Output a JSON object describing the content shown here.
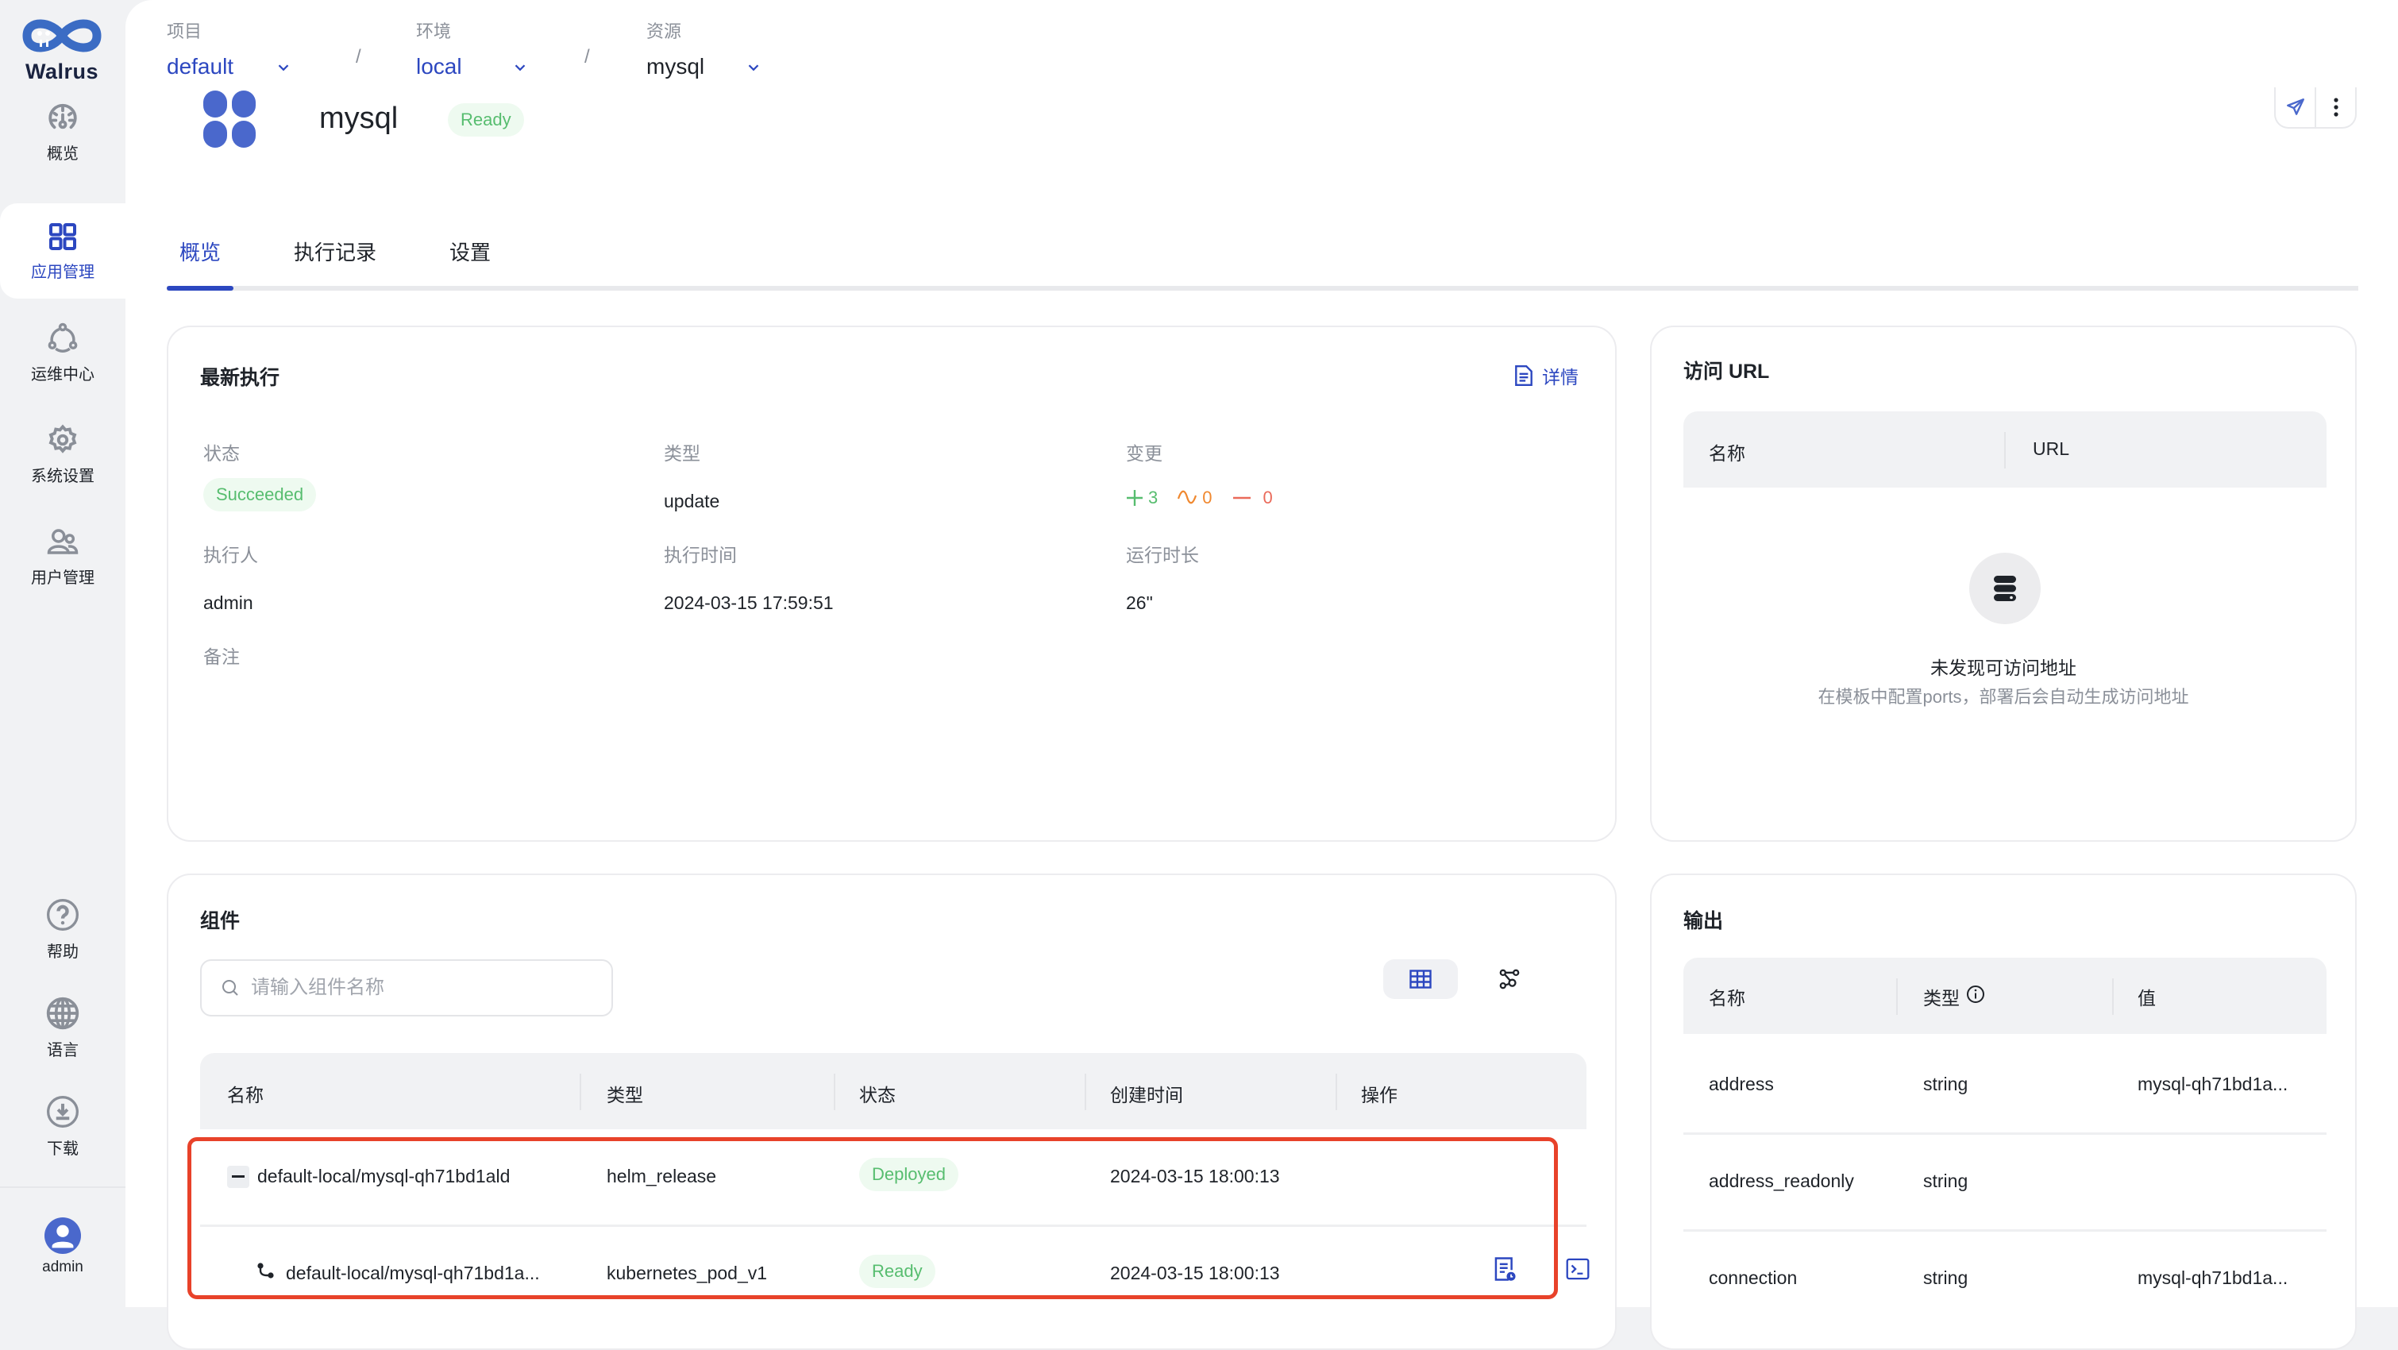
{
  "brand": {
    "name": "Walrus",
    "accent": "#2c47c0",
    "logo_color": "#3b6cc4"
  },
  "sidebar": {
    "items": [
      {
        "label": "概览",
        "icon": "dashboard-gauge-icon",
        "active": false
      },
      {
        "label": "应用管理",
        "icon": "app-grid-icon",
        "active": true
      },
      {
        "label": "运维中心",
        "icon": "ops-cycle-icon",
        "active": false
      },
      {
        "label": "系统设置",
        "icon": "gear-icon",
        "active": false
      },
      {
        "label": "用户管理",
        "icon": "users-icon",
        "active": false
      }
    ],
    "bottom_items": [
      {
        "label": "帮助",
        "icon": "help-circle-icon"
      },
      {
        "label": "语言",
        "icon": "globe-icon"
      },
      {
        "label": "下载",
        "icon": "download-icon"
      }
    ],
    "user": {
      "name": "admin",
      "icon": "avatar-icon"
    }
  },
  "breadcrumb": {
    "project": {
      "key": "项目",
      "value": "default"
    },
    "environment": {
      "key": "环境",
      "value": "local"
    },
    "resource": {
      "key": "资源",
      "value": "mysql"
    },
    "separator": "/"
  },
  "resource": {
    "name": "mysql",
    "status": "Ready",
    "icon": "resource-clover-icon",
    "actions": [
      {
        "icon": "send-icon"
      },
      {
        "icon": "more-vertical-icon"
      }
    ]
  },
  "tabs": [
    {
      "label": "概览",
      "active": true
    },
    {
      "label": "执行记录",
      "active": false
    },
    {
      "label": "设置",
      "active": false
    }
  ],
  "latest_run": {
    "title": "最新执行",
    "detail_link": "详情",
    "fields": {
      "status": {
        "label": "状态",
        "value": "Succeeded"
      },
      "type": {
        "label": "类型",
        "value": "update"
      },
      "changes": {
        "label": "变更",
        "added": "3",
        "modified": "0",
        "deleted": "0"
      },
      "executor": {
        "label": "执行人",
        "value": "admin"
      },
      "exec_time": {
        "label": "执行时间",
        "value": "2024-03-15 17:59:51"
      },
      "duration": {
        "label": "运行时长",
        "value": "26\""
      },
      "note": {
        "label": "备注",
        "value": ""
      }
    },
    "change_colors": {
      "added": "#57bd6f",
      "modified": "#f0882f",
      "deleted": "#ea6a5a"
    }
  },
  "access_url": {
    "title": "访问 URL",
    "columns": [
      "名称",
      "URL"
    ],
    "empty_title": "未发现可访问地址",
    "empty_desc": "在模板中配置ports，部署后会自动生成访问地址"
  },
  "components": {
    "title": "组件",
    "search_placeholder": "请输入组件名称",
    "search_value": "",
    "view_modes": [
      {
        "icon": "table-view-icon",
        "active": true
      },
      {
        "icon": "graph-view-icon",
        "active": false
      }
    ],
    "columns": [
      "名称",
      "类型",
      "状态",
      "创建时间",
      "操作"
    ],
    "rows": [
      {
        "name": "default-local/mysql-qh71bd1ald",
        "type": "helm_release",
        "status": "Deployed",
        "created": "2024-03-15 18:00:13",
        "expanded": true,
        "child": false,
        "actions": []
      },
      {
        "name": "default-local/mysql-qh71bd1a...",
        "type": "kubernetes_pod_v1",
        "status": "Ready",
        "created": "2024-03-15 18:00:13",
        "expanded": false,
        "child": true,
        "actions": [
          "logs-icon",
          "terminal-icon"
        ]
      }
    ]
  },
  "outputs": {
    "title": "输出",
    "columns": [
      "名称",
      "类型",
      "值"
    ],
    "rows": [
      {
        "name": "address",
        "type": "string",
        "value": "mysql-qh71bd1a..."
      },
      {
        "name": "address_readonly",
        "type": "string",
        "value": ""
      },
      {
        "name": "connection",
        "type": "string",
        "value": "mysql-qh71bd1a..."
      }
    ]
  }
}
